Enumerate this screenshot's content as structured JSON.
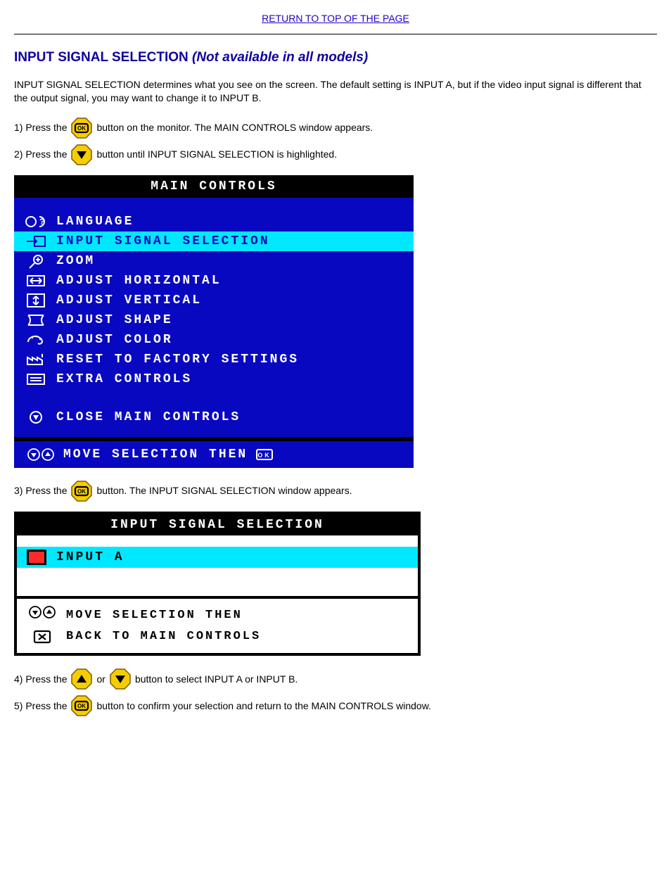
{
  "top_link": "RETURN TO TOP OF THE PAGE",
  "section": {
    "title_prefix": "INPUT SIGNAL SELECTION ",
    "title_note_italic": "(Not available in all models)",
    "intro": "INPUT SIGNAL SELECTION determines what you see on the screen. The default setting is INPUT A, but if the video input signal is different that the output signal, you may want to change it to INPUT B."
  },
  "steps": {
    "s1_a": "1) Press the ",
    "s1_b": " button on the monitor. The MAIN CONTROLS window appears.",
    "s2_a": "2) Press the ",
    "s2_b": " button until INPUT SIGNAL SELECTION is highlighted.",
    "s3_a": "3) Press the ",
    "s3_b": " button. The INPUT SIGNAL SELECTION window appears.",
    "s4_a": "4) Press the ",
    "s4_mid": " or ",
    "s4_b": " button to select INPUT A or INPUT B.",
    "s5_a": "5) Press the ",
    "s5_b": " button to confirm your selection and return to the MAIN CONTROLS window."
  },
  "osd_main": {
    "title": "MAIN CONTROLS",
    "items": [
      {
        "label": "LANGUAGE",
        "icon": "lang"
      },
      {
        "label": "INPUT SIGNAL SELECTION",
        "icon": "input",
        "selected": true
      },
      {
        "label": "ZOOM",
        "icon": "zoom"
      },
      {
        "label": "ADJUST HORIZONTAL",
        "icon": "horiz"
      },
      {
        "label": "ADJUST VERTICAL",
        "icon": "vert"
      },
      {
        "label": "ADJUST SHAPE",
        "icon": "shape"
      },
      {
        "label": "ADJUST COLOR",
        "icon": "color"
      },
      {
        "label": "RESET TO FACTORY SETTINGS",
        "icon": "factory"
      },
      {
        "label": "EXTRA CONTROLS",
        "icon": "extra"
      }
    ],
    "close_label": "CLOSE MAIN CONTROLS",
    "footer_label": "MOVE SELECTION THEN"
  },
  "osd_input": {
    "title": "INPUT SIGNAL SELECTION",
    "option_label": "INPUT A",
    "footer_line1": "MOVE SELECTION THEN",
    "footer_line2": "BACK TO MAIN CONTROLS"
  }
}
